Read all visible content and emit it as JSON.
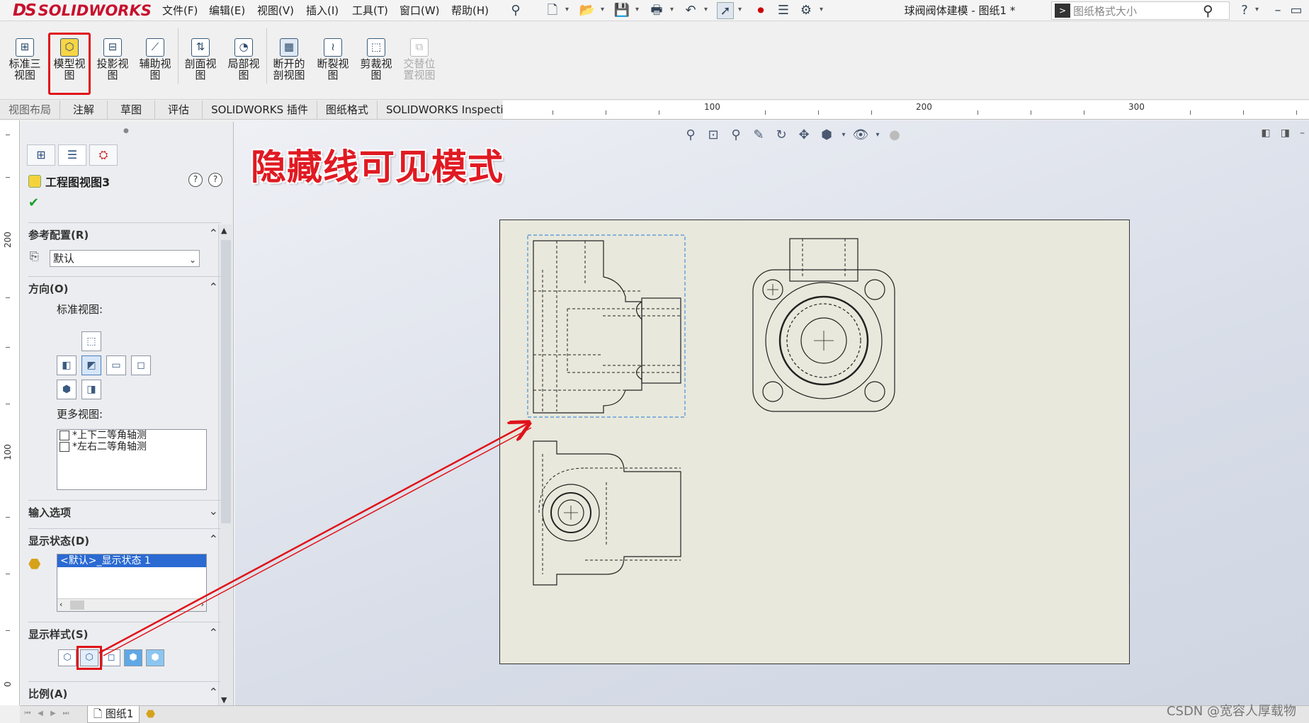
{
  "app": {
    "logo": "SOLIDWORKS",
    "logo_mark": "DS",
    "document_title": "球阀阀体建模 - 图纸1 *"
  },
  "menu": [
    "文件(F)",
    "编辑(E)",
    "视图(V)",
    "插入(I)",
    "工具(T)",
    "窗口(W)",
    "帮助(H)"
  ],
  "search": {
    "value": "图纸格式大小"
  },
  "ribbon": {
    "buttons": [
      {
        "label": "标准三视图",
        "icon": "standard-3-view-icon"
      },
      {
        "label": "模型视图",
        "icon": "model-view-icon"
      },
      {
        "label": "投影视图",
        "icon": "projected-view-icon"
      },
      {
        "label": "辅助视图",
        "icon": "auxiliary-view-icon"
      },
      {
        "label": "剖面视图",
        "icon": "section-view-icon"
      },
      {
        "label": "局部视图",
        "icon": "detail-view-icon"
      },
      {
        "label": "断开的剖视图",
        "icon": "broken-out-section-icon"
      },
      {
        "label": "断裂视图",
        "icon": "break-view-icon"
      },
      {
        "label": "剪裁视图",
        "icon": "crop-view-icon"
      },
      {
        "label": "交替位置视图",
        "icon": "alternate-position-view-icon",
        "disabled": true
      }
    ]
  },
  "tabs": [
    "视图布局",
    "注解",
    "草图",
    "评估",
    "SOLIDWORKS 插件",
    "图纸格式",
    "SOLIDWORKS Inspection"
  ],
  "hruler": {
    "labels": [
      "100",
      "200",
      "300"
    ]
  },
  "vruler": {
    "labels": [
      "200",
      "100",
      "0"
    ]
  },
  "panel": {
    "title": "工程图视图3",
    "help_a": "?",
    "help_b": "?",
    "sections": {
      "ref_config": {
        "title": "参考配置(R)",
        "value": "默认"
      },
      "orientation": {
        "title": "方向(O)",
        "standard_views_label": "标准视图:",
        "more_views_label": "更多视图:",
        "more_views": [
          "*上下二等角轴测",
          "*左右二等角轴测"
        ]
      },
      "import_options": {
        "title": "输入选项"
      },
      "display_state": {
        "title": "显示状态(D)",
        "selected": "<默认>_显示状态 1"
      },
      "display_style": {
        "title": "显示样式(S)"
      },
      "scale": {
        "title": "比例(A)"
      }
    }
  },
  "sheet_tab": "图纸1",
  "annotation": "隐藏线可见模式",
  "watermark": "CSDN @宽容人厚载物"
}
